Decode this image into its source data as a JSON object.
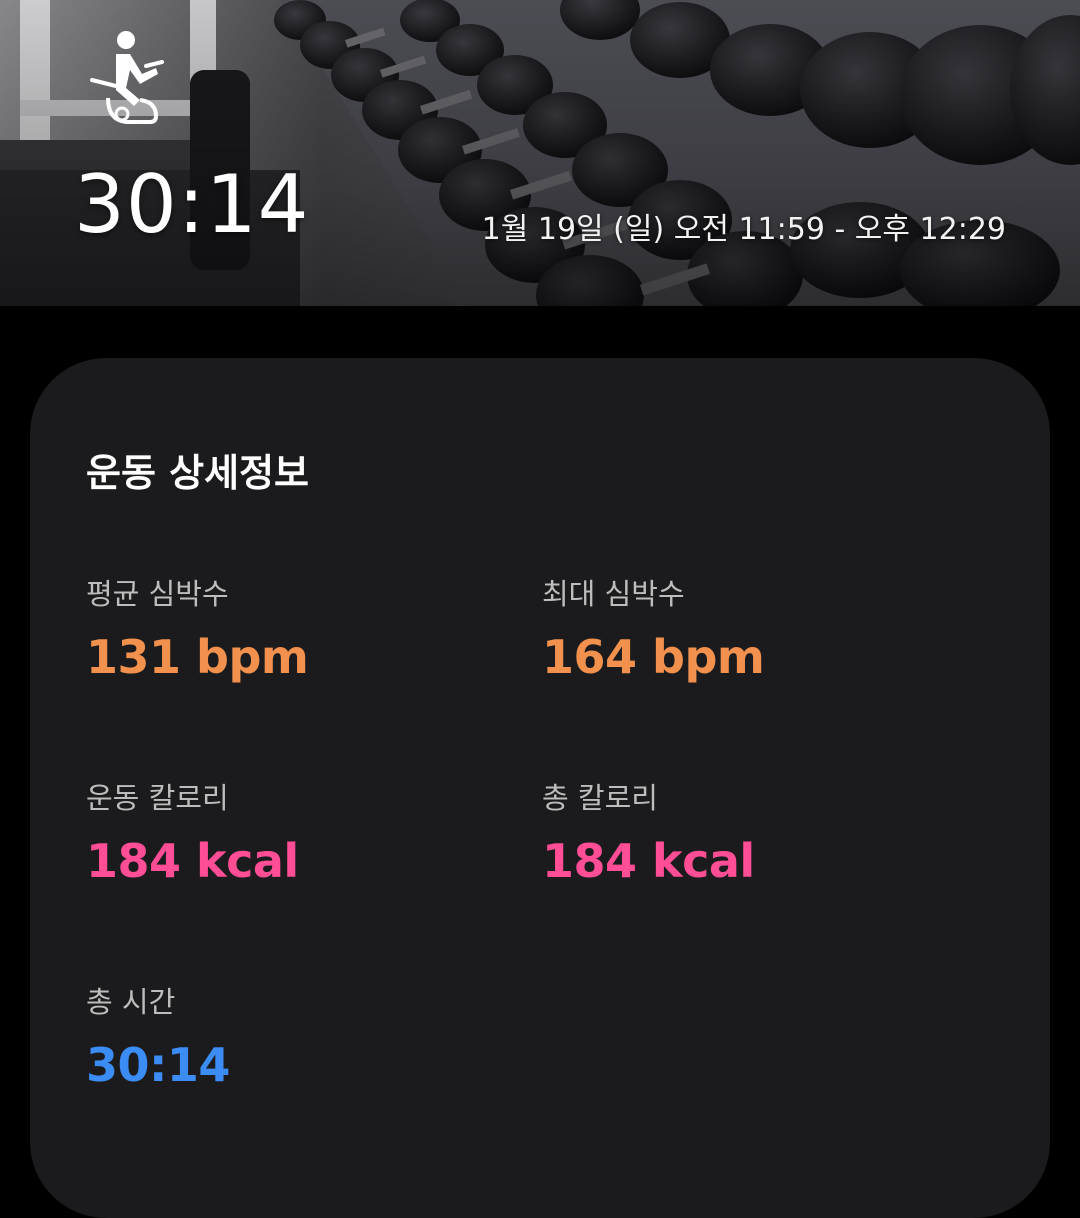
{
  "header": {
    "exercise_icon": "stationary-bike-icon",
    "duration": "30:14",
    "time_range": "1월 19일 (일) 오전 11:59 - 오후 12:29"
  },
  "details": {
    "title": "운동 상세정보",
    "avg_heart_rate": {
      "label": "평균 심박수",
      "value": "131 bpm"
    },
    "max_heart_rate": {
      "label": "최대 심박수",
      "value": "164 bpm"
    },
    "workout_calories": {
      "label": "운동 칼로리",
      "value": "184 kcal"
    },
    "total_calories": {
      "label": "총 칼로리",
      "value": "184 kcal"
    },
    "total_time": {
      "label": "총 시간",
      "value": "30:14"
    }
  },
  "colors": {
    "heart_rate": "#f1914d",
    "calories": "#ff4d96",
    "time": "#3b8cf4",
    "card_background": "#1b1b1d"
  }
}
